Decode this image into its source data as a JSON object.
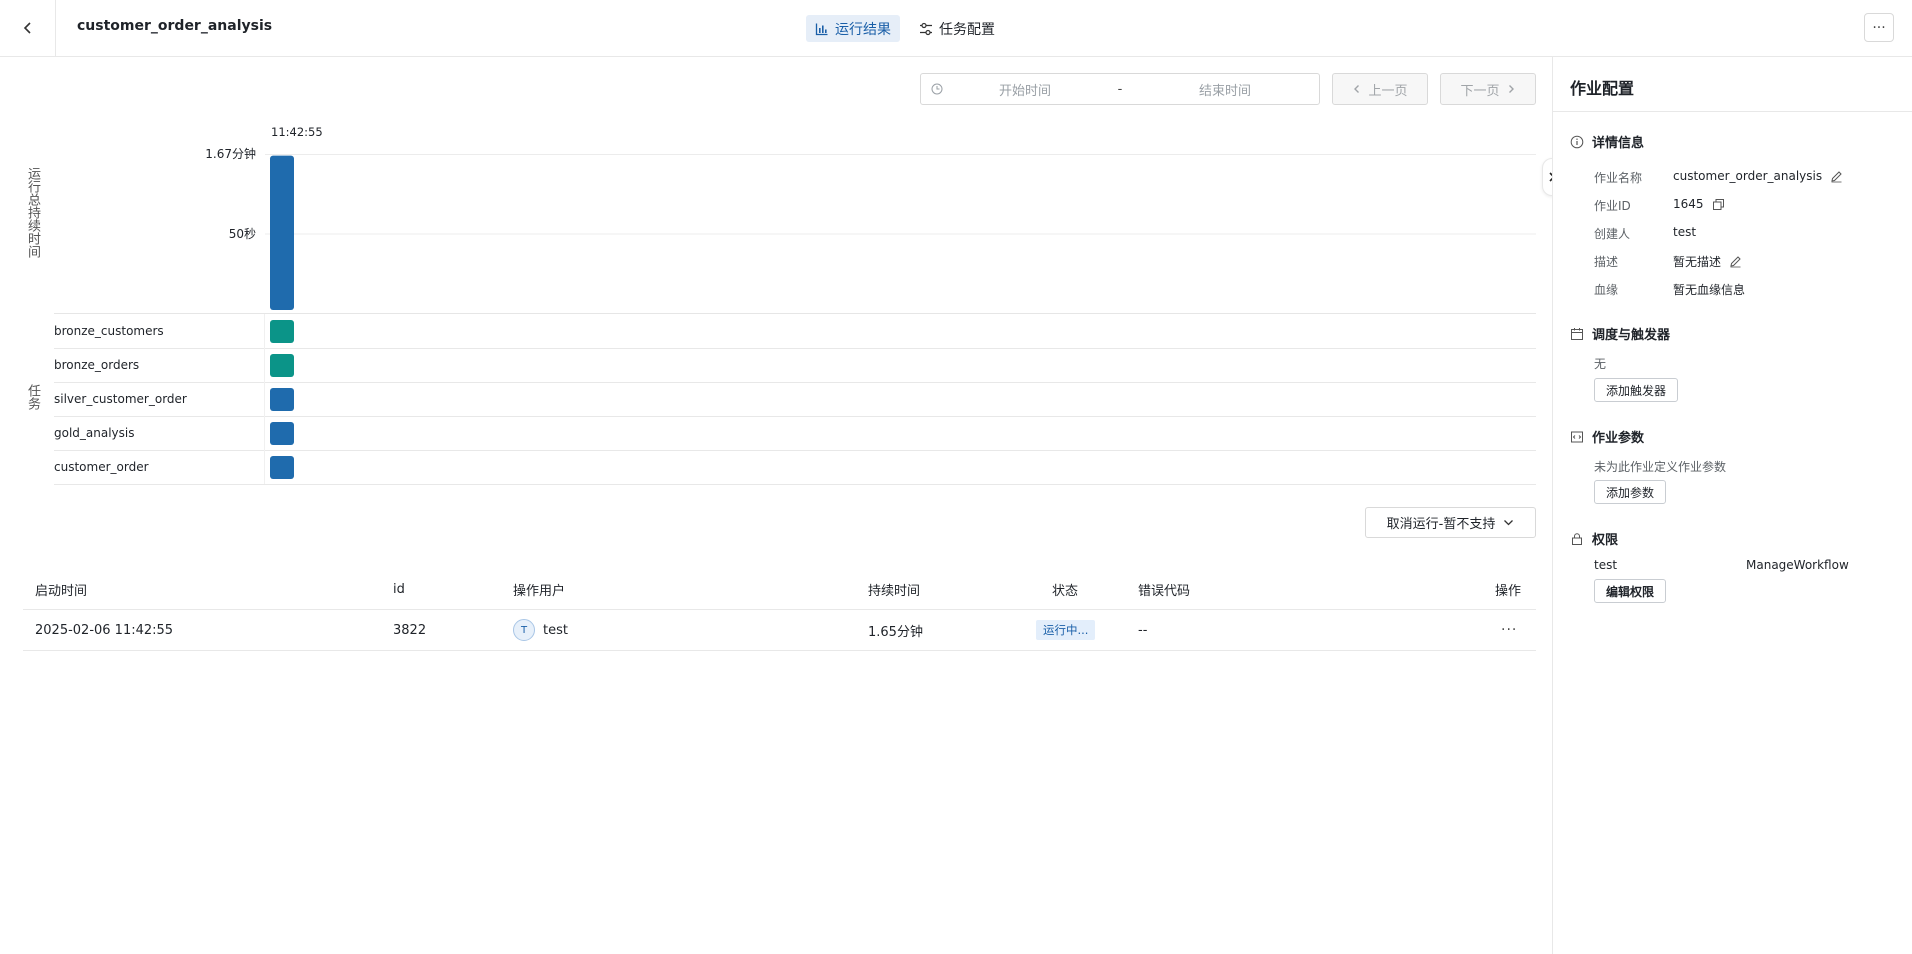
{
  "header": {
    "job_name": "customer_order_analysis",
    "tabs": [
      {
        "label": "运行结果",
        "active": true
      },
      {
        "label": "任务配置",
        "active": false
      }
    ],
    "more_label": "···"
  },
  "toolbar": {
    "start_placeholder": "开始时间",
    "separator": "-",
    "end_placeholder": "结束时间",
    "prev_label": "上一页",
    "next_label": "下一页"
  },
  "chart_data": {
    "type": "bar",
    "run_time_label": "11:42:55",
    "y_title_duration": "运行总持续时间",
    "y_title_tasks": "任务",
    "y_ticks": [
      "1.67分钟",
      "50秒"
    ],
    "y_tick_values_seconds": [
      100,
      50
    ],
    "runs": [
      {
        "start": "11:42:55",
        "duration_seconds": 99,
        "color": "#1f6bad"
      }
    ],
    "tasks": [
      {
        "name": "bronze_customers",
        "color": "#0b9488"
      },
      {
        "name": "bronze_orders",
        "color": "#0b9488"
      },
      {
        "name": "silver_customer_order",
        "color": "#1f6bad"
      },
      {
        "name": "gold_analysis",
        "color": "#1f6bad"
      },
      {
        "name": "customer_order",
        "color": "#1f6bad"
      }
    ]
  },
  "cancel_button": {
    "label": "取消运行-暂不支持"
  },
  "table": {
    "columns": [
      "启动时间",
      "id",
      "操作用户",
      "持续时间",
      "状态",
      "错误代码",
      "操作"
    ],
    "rows": [
      {
        "start_time": "2025-02-06 11:42:55",
        "id": "3822",
        "user_initial": "T",
        "user": "test",
        "duration": "1.65分钟",
        "status": "运行中...",
        "error_code": "--",
        "action": "···"
      }
    ]
  },
  "panel": {
    "title": "作业配置",
    "details": {
      "heading": "详情信息",
      "job_name_key": "作业名称",
      "job_name_val": "customer_order_analysis",
      "job_id_key": "作业ID",
      "job_id_val": "1645",
      "creator_key": "创建人",
      "creator_val": "test",
      "desc_key": "描述",
      "desc_val": "暂无描述",
      "lineage_key": "血缘",
      "lineage_val": "暂无血缘信息"
    },
    "schedule": {
      "heading": "调度与触发器",
      "value": "无",
      "button": "添加触发器"
    },
    "params": {
      "heading": "作业参数",
      "empty_text": "未为此作业定义作业参数",
      "button": "添加参数"
    },
    "permissions": {
      "heading": "权限",
      "user": "test",
      "permission": "ManageWorkflow",
      "button": "编辑权限"
    }
  }
}
